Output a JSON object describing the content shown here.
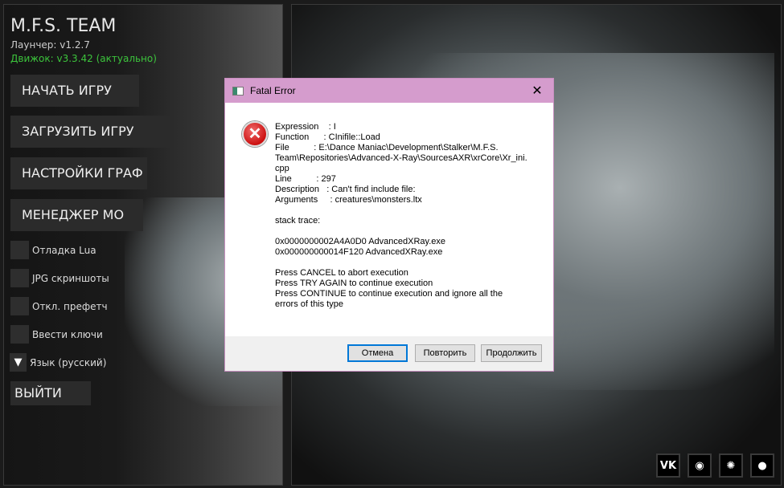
{
  "launcher": {
    "title": "M.F.S. TEAM",
    "launcher_version": "Лаунчер: v1.2.7",
    "engine_version": "Движок: v3.3.42 (актуально)",
    "menu": [
      "НАЧАТЬ ИГРУ",
      "ЗАГРУЗИТЬ ИГРУ",
      "НАСТРОЙКИ ГРАФ",
      "МЕНЕДЖЕР МО"
    ],
    "options": [
      "Отладка Lua",
      "JPG скриншоты",
      "Откл. префетч",
      "Ввести ключи"
    ],
    "language": "Язык (русский)",
    "exit": "ВЫЙТИ",
    "social": [
      {
        "icon": "vk-icon",
        "label": "VK"
      },
      {
        "icon": "discord-icon",
        "label": ""
      },
      {
        "icon": "clock-logo-icon",
        "label": ""
      },
      {
        "icon": "github-icon",
        "label": ""
      }
    ],
    "colors": {
      "engine": "#3cc43c"
    }
  },
  "dialog": {
    "title": "Fatal Error",
    "message": "Expression    : I\nFunction      : CInifile::Load\nFile          : E:\\Dance Maniac\\Development\\Stalker\\M.F.S.\nTeam\\Repositories\\Advanced-X-Ray\\SourcesAXR\\xrCore\\Xr_ini.\ncpp\nLine          : 297\nDescription   : Can't find include file:\nArguments     : creatures\\monsters.ltx\n\nstack trace:\n\n0x0000000002A4A0D0 AdvancedXRay.exe\n0x000000000014F120 AdvancedXRay.exe\n\nPress CANCEL to abort execution\nPress TRY AGAIN to continue execution\nPress CONTINUE to continue execution and ignore all the\nerrors of this type",
    "buttons": {
      "cancel": "Отмена",
      "retry": "Повторить",
      "continue": "Продолжить"
    }
  }
}
